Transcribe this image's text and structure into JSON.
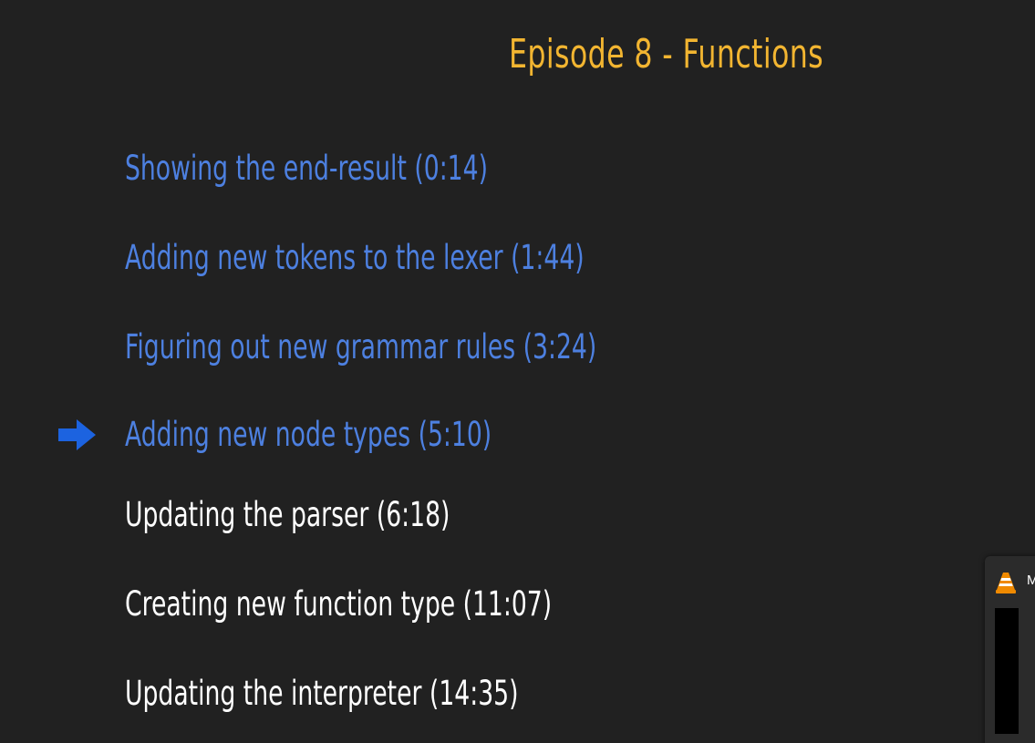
{
  "slide": {
    "title": "Episode 8 - Functions",
    "items": [
      {
        "label": "Showing the end-result (0:14)",
        "state": "done"
      },
      {
        "label": "Adding new tokens to the lexer (1:44)",
        "state": "done"
      },
      {
        "label": "Figuring out new grammar rules (3:24)",
        "state": "done"
      },
      {
        "label": "Adding new node types (5:10)",
        "state": "current"
      },
      {
        "label": "Updating the parser (6:18)",
        "state": "todo"
      },
      {
        "label": "Creating new function type (11:07)",
        "state": "todo"
      },
      {
        "label": "Updating the interpreter (14:35)",
        "state": "todo"
      }
    ],
    "current_marker_icon": "arrow-right-icon"
  },
  "taskbar_preview": {
    "app_icon": "vlc-cone-icon",
    "title": "M"
  },
  "colors": {
    "title": "#f2b531",
    "done": "#4d80e0",
    "todo": "#ffffff",
    "arrow": "#1c63e0",
    "background": "#212121"
  }
}
